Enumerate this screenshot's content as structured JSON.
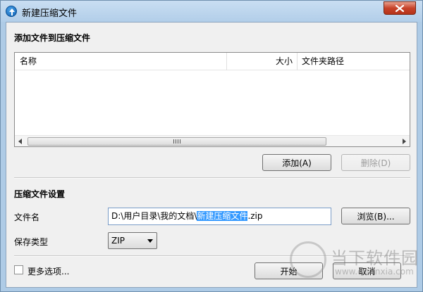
{
  "window": {
    "title": "新建压缩文件",
    "close_icon": "close-icon"
  },
  "add_section": {
    "title": "添加文件到压缩文件",
    "columns": [
      "名称",
      "大小",
      "文件夹路径"
    ],
    "rows": [],
    "add_button": "添加(A)",
    "delete_button": "删除(D)"
  },
  "settings": {
    "title": "压缩文件设置",
    "filename_label": "文件名",
    "filename_prefix": "D:\\用户目录\\我的文档\\",
    "filename_selected": "新建压缩文件",
    "filename_suffix": ".zip",
    "browse_button": "浏览(B)...",
    "type_label": "保存类型",
    "type_value": "ZIP"
  },
  "footer": {
    "more_options": "更多选项...",
    "start_button": "开始",
    "cancel_button": "取消"
  },
  "watermark": {
    "text": "当下软件园",
    "url": "www.downxia.com"
  },
  "colors": {
    "selection": "#3399ff",
    "title_bar": "#b2cee9",
    "close_button": "#c7432a"
  }
}
